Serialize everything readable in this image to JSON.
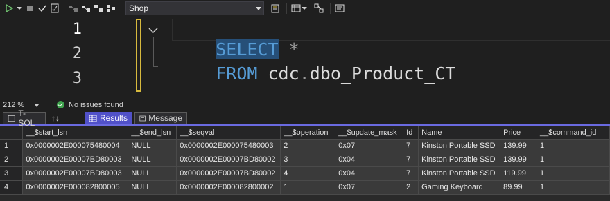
{
  "toolbar": {
    "database": "Shop",
    "icons": [
      "play-icon",
      "dropdown-icon",
      "stop-icon",
      "check-icon",
      "parse-icon",
      "display-plan-icon",
      "include-plan-icon",
      "include-stats-icon",
      "client-stats-icon",
      "results-grid-icon",
      "results-text-icon",
      "results-file-icon"
    ]
  },
  "editor": {
    "line_numbers": [
      "1",
      "2",
      "3"
    ],
    "line1": {
      "keyword": "SELECT",
      "star": "*"
    },
    "line2": {
      "keyword": "FROM",
      "schema": "cdc",
      "dot": ".",
      "table": "dbo_Product_CT"
    },
    "colors": {
      "keyword": "#569cd6",
      "gutter": "#ffffff",
      "change_bar": "#d7ba3e"
    }
  },
  "status": {
    "zoom": "212 %",
    "issues": "No issues found"
  },
  "tabs": {
    "tsql": "T-SQL",
    "arrows": "↑↓",
    "results": "Results",
    "message": "Message"
  },
  "grid": {
    "columns": [
      "__$start_lsn",
      "__$end_lsn",
      "__$seqval",
      "__$operation",
      "__$update_mask",
      "Id",
      "Name",
      "Price",
      "__$command_id"
    ],
    "rows": [
      {
        "num": "1",
        "cells": [
          "0x0000002E000075480004",
          "NULL",
          "0x0000002E000075480003",
          "2",
          "0x07",
          "7",
          "Kinston Portable SSD",
          "139.99",
          "1"
        ]
      },
      {
        "num": "2",
        "cells": [
          "0x0000002E00007BD80003",
          "NULL",
          "0x0000002E00007BD80002",
          "3",
          "0x04",
          "7",
          "Kinston Portable SSD",
          "139.99",
          "1"
        ]
      },
      {
        "num": "3",
        "cells": [
          "0x0000002E00007BD80003",
          "NULL",
          "0x0000002E00007BD80002",
          "4",
          "0x04",
          "7",
          "Kinston Portable SSD",
          "119.99",
          "1"
        ]
      },
      {
        "num": "4",
        "cells": [
          "0x0000002E000082800005",
          "NULL",
          "0x0000002E000082800002",
          "1",
          "0x07",
          "2",
          "Gaming Keyboard",
          "89.99",
          "1"
        ]
      }
    ]
  }
}
